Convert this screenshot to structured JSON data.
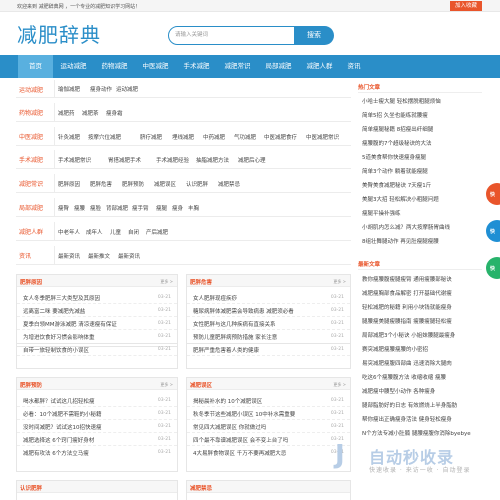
{
  "topbar": {
    "welcome": "欢迎来到 减肥辞典网 ，一个专业的减肥知识学习网站！",
    "favorite": "加入收藏"
  },
  "site": {
    "logo": "减肥辞典"
  },
  "search": {
    "placeholder": "请输入关键词",
    "button": "搜索"
  },
  "nav": [
    "首页",
    "运动减肥",
    "药物减肥",
    "中医减肥",
    "手术减肥",
    "减肥常识",
    "局部减肥",
    "减肥人群",
    "资讯"
  ],
  "categories": [
    {
      "title": "运动减肥",
      "tags": [
        "瑜伽减肥",
        "瘦身动作",
        "运动减肥"
      ]
    },
    {
      "title": "药物减肥",
      "tags": [
        "减肥药",
        "减肥茶",
        "瘦身霜"
      ]
    },
    {
      "title": "中医减肥",
      "tags": [
        "针灸减肥",
        "按摩穴位减肥",
        "脐疗减肥",
        "埋线减肥",
        "中药减肥",
        "气功减肥",
        "中医减肥食疗",
        "中医减肥常识"
      ]
    },
    {
      "title": "手术减肥",
      "tags": [
        "手术减肥常识",
        "胃搭减肥手术",
        "手术减肥经验",
        "抽脂减肥方法",
        "减肥后心理"
      ]
    },
    {
      "title": "减肥常识",
      "tags": [
        "肥胖原因",
        "肥胖危害",
        "肥胖预防",
        "减肥误区",
        "认识肥胖",
        "减肥禁忌"
      ]
    },
    {
      "title": "局部减肥",
      "tags": [
        "瘦臀",
        "瘦腰",
        "瘦脸",
        "背部减肥",
        "瘦手臂",
        "瘦腿",
        "瘦身",
        "丰胸"
      ]
    },
    {
      "title": "减肥人群",
      "tags": [
        "中老年人",
        "成年人",
        "儿童",
        "自闭",
        "产后减肥"
      ]
    },
    {
      "title": "资讯",
      "tags": [
        "最新资讯",
        "最新推文",
        "最新资讯"
      ]
    }
  ],
  "boxes": [
    {
      "title": "肥胖原因",
      "more": "更多 >",
      "items": [
        {
          "t": "女人冬季肥胖三大类型及其原因",
          "d": "03-21"
        },
        {
          "t": "远离富二咪 要减肥先减盐",
          "d": "03-21"
        },
        {
          "t": "夏季白领MM游泳减肥 清凉速瘦有保证",
          "d": "03-21"
        },
        {
          "t": "为增进饮食好习惯会影响体重",
          "d": "03-21"
        },
        {
          "t": "自带一旅轻制饮食的小误区",
          "d": "03-21"
        }
      ]
    },
    {
      "title": "肥胖危害",
      "more": "更多 >",
      "items": [
        {
          "t": "女人肥胖现痘疾痧",
          "d": "03-21"
        },
        {
          "t": "糖尿病胖体减肥需会导致病患 减肥须必看",
          "d": "03-21"
        },
        {
          "t": "女性肥胖与这几种疾病有直接关系",
          "d": "03-21"
        },
        {
          "t": "预防儿童肥胖病预防措施 家长注意",
          "d": "03-21"
        },
        {
          "t": "肥胖严重危害着人类的健康",
          "d": "03-21"
        }
      ]
    },
    {
      "title": "肥胖预防",
      "more": "更多 >",
      "items": [
        {
          "t": "喝水都胖？试试这几招轻松瘦",
          "d": "03-21"
        },
        {
          "t": "必看：10个减肥不需鞋的小秘籍",
          "d": "03-21"
        },
        {
          "t": "没时间减肥？试试这10招快速瘦",
          "d": "03-21"
        },
        {
          "t": "减肥选择这 6个窍门瘦好身材",
          "d": "03-21"
        },
        {
          "t": "减肥有攻法 6个方法立马瘦",
          "d": "03-21"
        }
      ]
    },
    {
      "title": "减肥误区",
      "more": "更多 >",
      "items": [
        {
          "t": "揭秘晨补水的 10个减肥误区",
          "d": "03-21"
        },
        {
          "t": "秋冬季节这些减肥小误区 10中补水需重要",
          "d": "03-21"
        },
        {
          "t": "常见四大减肥误区 你就做过吗",
          "d": "03-21"
        },
        {
          "t": "四个最不靠谱减肥误区 会不变上台了吗",
          "d": "03-21"
        },
        {
          "t": "4大易胖食物误区 千万不要再减肥大忌",
          "d": "03-21"
        }
      ]
    },
    {
      "title": "认识肥胖",
      "more": "",
      "items": [
        {
          "t": "",
          "d": ""
        }
      ]
    },
    {
      "title": "减肥禁忌",
      "more": "",
      "items": [
        {
          "t": "",
          "d": ""
        }
      ]
    }
  ],
  "sidebar": {
    "hot_title": "热门文章",
    "hot": [
      "小哈士瘦大腿 轻松摆脱粗腿烦恼",
      "简单5招 久坐也能练就腰瘦",
      "简单瘦腿秘籍 8招瘦出纤细腿",
      "瘦腰腹的7个超级秘诀的大法",
      "5道美食帮你快速瘦身瘦腿",
      "简单3个动作 躺着就能瘦腿",
      "美臀美食减肥秘诀 7天瘦1斤",
      "美腿3大招 轻松解决小粗腿问题",
      "瘦腿平操补强练",
      "小胡肌内怎么减？两大按摩肠胃曲线",
      "8组壮舞腿动作 再见肚瘦腿瘦腰"
    ],
    "new_title": "最新文章",
    "new": [
      "教你瘦腰腹瘦腿瘦臂 通用瘦腰部秘诀",
      "减肥瘦胸部食品解密 打开基础代谢瘦",
      "轻松减肥的秘籍 利用小块钱就能瘦身",
      "腿腰瘦美腿瘦腰指南 瘦腰瘦腿轻松瘦",
      "局部减肥3个小秘诀 小姐妹腰腿最瘦身",
      "赛突减肥瘦腰瘦腰的小密招",
      "易突减肥瘦腹四部曲 迅速消除大腿肉",
      "吃这6个瘦腰腹方法 收缩收缩 瘦腰",
      "减肥瘦中腰型小动作 各种瘦身",
      "腿部脂肪好的日志 有效燃烧上半身脂肪",
      "帮你瘦出正确瘦身活法 健身轻松瘦身",
      "N个方法专减小肚腩 腿腰瘦腹你消除byebye"
    ]
  },
  "float_buttons": [
    {
      "label": "快",
      "color": "#e9552b"
    },
    {
      "label": "快",
      "color": "#1f8fd4"
    },
    {
      "label": "快",
      "color": "#27b36b"
    }
  ],
  "watermark": {
    "logo": "J",
    "title": "自动秒收录",
    "sub": "快速收录 · 来访一收 · 自动登录"
  }
}
